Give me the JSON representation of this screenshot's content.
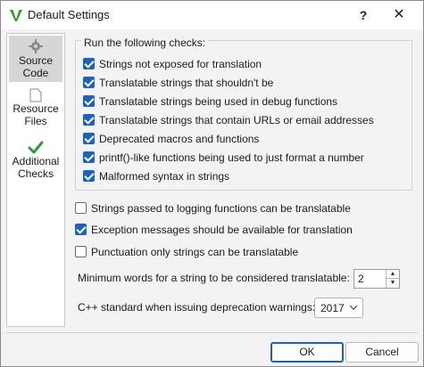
{
  "window": {
    "title": "Default Settings",
    "help_label": "?",
    "close_label": "✕"
  },
  "sidebar": {
    "items": [
      {
        "label_1": "Source",
        "label_2": "Code",
        "icon": "gear-icon",
        "selected": true
      },
      {
        "label_1": "Resource",
        "label_2": "Files",
        "icon": "file-icon",
        "selected": false
      },
      {
        "label_1": "Additional",
        "label_2": "Checks",
        "icon": "checkmark-icon",
        "selected": false
      }
    ]
  },
  "checks_group": {
    "title": "Run the following checks:",
    "items": [
      {
        "label": "Strings not exposed for translation",
        "checked": true
      },
      {
        "label": "Translatable strings that shouldn't be",
        "checked": true
      },
      {
        "label": "Translatable strings being used in debug functions",
        "checked": true
      },
      {
        "label": "Translatable strings that contain URLs or email addresses",
        "checked": true
      },
      {
        "label": "Deprecated macros and functions",
        "checked": true
      },
      {
        "label": "printf()-like functions being used to just format a number",
        "checked": true
      },
      {
        "label": "Malformed syntax in strings",
        "checked": true
      }
    ]
  },
  "options": [
    {
      "label": "Strings passed to logging functions can be translatable",
      "checked": false
    },
    {
      "label": "Exception messages should be available for translation",
      "checked": true
    },
    {
      "label": "Punctuation only strings can be translatable",
      "checked": false
    }
  ],
  "min_words": {
    "label": "Minimum words for a string to be considered translatable:",
    "value": "2"
  },
  "cpp_standard": {
    "label": "C++ standard when issuing deprecation warnings:",
    "value": "2017"
  },
  "buttons": {
    "ok": "OK",
    "cancel": "Cancel"
  },
  "colors": {
    "accent": "#1a63c4",
    "check_green": "#2a9d3a",
    "logo_green": "#3c9a2c"
  }
}
